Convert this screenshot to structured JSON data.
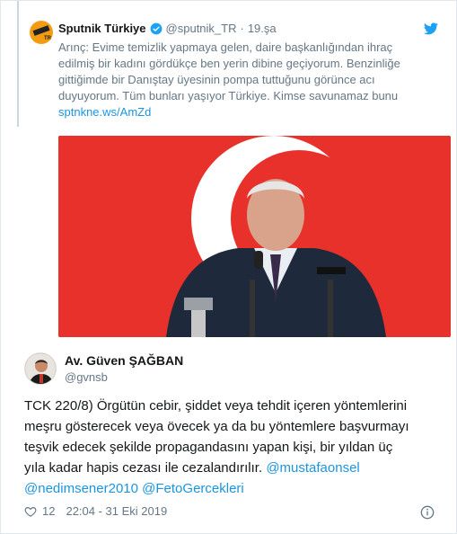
{
  "quoted": {
    "name": "Sputnik Türkiye",
    "handle": "@sputnik_TR",
    "dot": "·",
    "time": "19.şa",
    "text_lines": [
      "Arınç: Evime temizlik yapmaya gelen, daire başkanlığından ihraç",
      "edilmiş bir kadını gördükçe ben yerin dibine geçiyorum. Benzinliğe",
      "gittiğimde bir Danıştay üyesinin pompa tuttuğunu görünce acı",
      "duyuyorum. Tüm bunları yaşıyor Türkiye. Kimse savunamaz bunu"
    ],
    "link": "sptnkne.ws/AmZd",
    "avatar_badge": "TR"
  },
  "tweet": {
    "name": "Av. Güven ŞAĞBAN",
    "handle": "@gvnsb",
    "body_lines": [
      "TCK 220/8) Örgütün cebir, şiddet veya tehdit içeren yöntemlerini",
      "meşru gösterecek veya övecek ya da bu yöntemlere başvurmayı",
      "teşvik edecek şekilde propagandasını yapan kişi, bir yıldan üç",
      "yıla kadar hapis cezası ile cezalandırılır."
    ],
    "mentions": [
      "@mustafaonsel",
      "@nedimsener2010",
      "@FetoGercekleri"
    ],
    "likes": "12",
    "timestamp": "22:04 - 31 Eki 2019"
  },
  "icons": {
    "verified": "verified-badge-icon",
    "bird": "twitter-bird-icon",
    "heart": "heart-icon",
    "info": "info-icon"
  },
  "colors": {
    "link": "#1b95e0",
    "muted": "#657786",
    "flag_red": "#e8312b"
  }
}
